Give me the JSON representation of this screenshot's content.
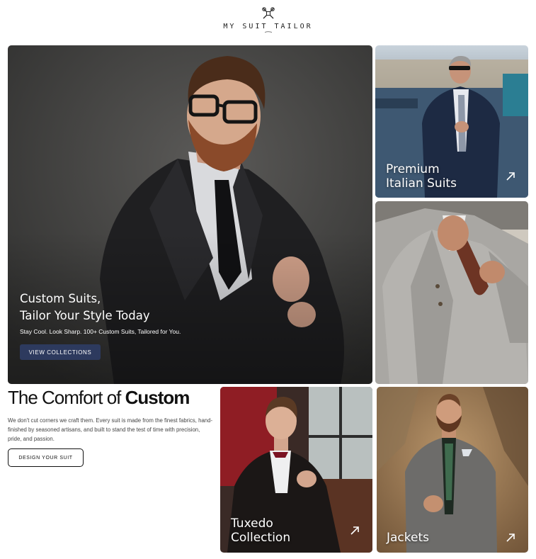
{
  "brand": {
    "name": "MY SUIT TAILOR"
  },
  "hero": {
    "title_line1": "Custom Suits,",
    "title_line2": "Tailor Your Style Today",
    "subtitle": "Stay Cool. Look Sharp. 100+ Custom Suits, Tailored for You.",
    "button_label": "VIEW COLLECTIONS"
  },
  "comfort": {
    "heading_light": "The Comfort of ",
    "heading_bold": "Custom",
    "body": "We don't cut corners we craft them. Every suit is made from the finest fabrics, hand-finished by seasoned artisans, and built to stand the test of time with precision, pride, and passion.",
    "button_label": "DESIGN YOUR SUIT"
  },
  "collections": {
    "premium": {
      "line1": "Premium",
      "line2": "Italian Suits",
      "icon": "arrow-up-right-icon"
    },
    "tuxedo": {
      "line1": "Tuxedo",
      "line2": "Collection",
      "icon": "arrow-up-right-icon"
    },
    "jackets": {
      "line1": "Jackets",
      "icon": "arrow-up-right-icon"
    }
  },
  "colors": {
    "accent_button": "#2d3a5e",
    "text": "#111111",
    "white": "#ffffff"
  }
}
